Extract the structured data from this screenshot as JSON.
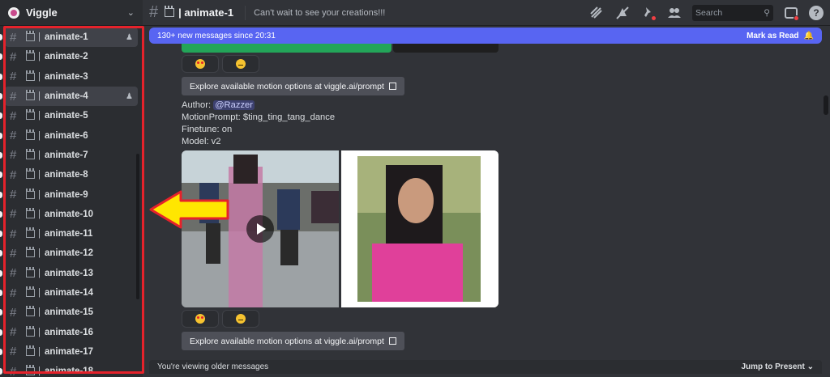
{
  "server": {
    "name": "Viggle"
  },
  "channels": [
    {
      "name": "animate-1",
      "active": true,
      "icon": "add-member"
    },
    {
      "name": "animate-2"
    },
    {
      "name": "animate-3"
    },
    {
      "name": "animate-4",
      "active": true,
      "icon": "add-member"
    },
    {
      "name": "animate-5"
    },
    {
      "name": "animate-6"
    },
    {
      "name": "animate-7"
    },
    {
      "name": "animate-8"
    },
    {
      "name": "animate-9"
    },
    {
      "name": "animate-10"
    },
    {
      "name": "animate-11"
    },
    {
      "name": "animate-12"
    },
    {
      "name": "animate-13"
    },
    {
      "name": "animate-14"
    },
    {
      "name": "animate-15"
    },
    {
      "name": "animate-16"
    },
    {
      "name": "animate-17"
    },
    {
      "name": "animate-18"
    }
  ],
  "topbar": {
    "channel": "animate-1",
    "topic": "Can't wait to see your creations!!!",
    "search_placeholder": "Search"
  },
  "newbar": {
    "text": "130+ new messages since 20:31",
    "action": "Mark as Read"
  },
  "message": {
    "explore_label": "Explore available motion options at viggle.ai/prompt",
    "author_label": "Author:",
    "author_mention": "@Razzer",
    "motion_prompt": "MotionPrompt: $ting_ting_tang_dance",
    "finetune": "Finetune: on",
    "model": "Model: v2"
  },
  "bottom": {
    "older": "You're viewing older messages",
    "jump": "Jump to Present"
  },
  "colors": {
    "accent": "#5865f2",
    "highlight_box": "#e5222b",
    "arrow_fill": "#ffe600"
  }
}
